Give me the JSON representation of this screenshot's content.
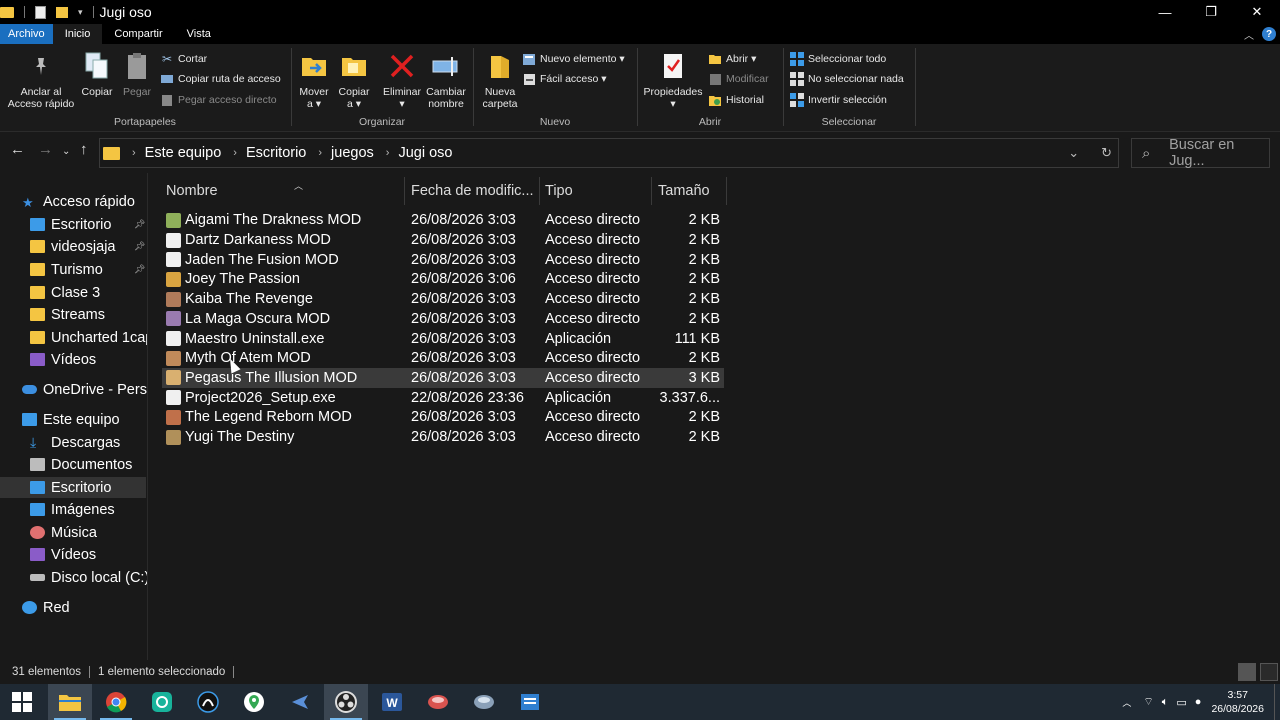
{
  "window": {
    "title": "Jugi oso",
    "minimize": "—",
    "maximize": "❐",
    "close": "✕"
  },
  "ribbon_tabs": [
    "Archivo",
    "Inicio",
    "Compartir",
    "Vista"
  ],
  "ribbon": {
    "portapapeles": {
      "label": "Portapapeles",
      "pin": "Anclar al\nAcceso rápido",
      "pin_l1": "Anclar al",
      "pin_l2": "Acceso rápido",
      "copy": "Copiar",
      "paste": "Pegar",
      "cut": "Cortar",
      "copy_path": "Copiar ruta de acceso",
      "paste_shortcut": "Pegar acceso directo"
    },
    "organizar": {
      "label": "Organizar",
      "move_l1": "Mover",
      "move_l2": "a ▾",
      "copyto_l1": "Copiar",
      "copyto_l2": "a ▾",
      "delete_l1": "Eliminar",
      "delete_l2": "▾",
      "rename_l1": "Cambiar",
      "rename_l2": "nombre"
    },
    "nuevo": {
      "label": "Nuevo",
      "folder_l1": "Nueva",
      "folder_l2": "carpeta",
      "new_item": "Nuevo elemento ▾",
      "easy_access": "Fácil acceso ▾"
    },
    "abrir": {
      "label": "Abrir",
      "props_l1": "Propiedades",
      "props_l2": "▾",
      "open": "Abrir ▾",
      "edit": "Modificar",
      "history": "Historial"
    },
    "seleccionar": {
      "label": "Seleccionar",
      "all": "Seleccionar todo",
      "none": "No seleccionar nada",
      "invert": "Invertir selección"
    }
  },
  "address": {
    "crumbs": [
      "Este equipo",
      "Escritorio",
      "juegos",
      "Jugi oso"
    ],
    "search_placeholder": "Buscar en Jug..."
  },
  "sidebar": [
    {
      "label": "Acceso rápido",
      "icon": "star-icon",
      "color": "#3c8fe0"
    },
    {
      "label": "Escritorio",
      "icon": "desktop-icon",
      "color": "#3c9be8",
      "pinned": true
    },
    {
      "label": "videosjaja",
      "icon": "folder-icon",
      "color": "#f4c542",
      "pinned": true
    },
    {
      "label": "Turismo",
      "icon": "folder-icon",
      "color": "#f4c542",
      "pinned": true
    },
    {
      "label": "Clase 3",
      "icon": "folder-icon",
      "color": "#f4c542"
    },
    {
      "label": "Streams",
      "icon": "folder-icon",
      "color": "#f4c542"
    },
    {
      "label": "Uncharted 1cap",
      "icon": "folder-icon",
      "color": "#f4c542"
    },
    {
      "label": "Vídeos",
      "icon": "video-icon",
      "color": "#8a5cc8"
    },
    {
      "label": "OneDrive - Perso",
      "icon": "cloud-icon",
      "color": "#3c8fe0"
    },
    {
      "label": "Este equipo",
      "icon": "computer-icon",
      "color": "#3c9be8"
    },
    {
      "label": "Descargas",
      "icon": "download-icon",
      "color": "#3c9be8"
    },
    {
      "label": "Documentos",
      "icon": "documents-icon",
      "color": "#bcbcbc"
    },
    {
      "label": "Escritorio",
      "icon": "desktop-icon",
      "color": "#3c9be8",
      "selected": true
    },
    {
      "label": "Imágenes",
      "icon": "pictures-icon",
      "color": "#3c9be8"
    },
    {
      "label": "Música",
      "icon": "music-icon",
      "color": "#e07070"
    },
    {
      "label": "Vídeos",
      "icon": "video-icon",
      "color": "#8a5cc8"
    },
    {
      "label": "Disco local (C:)",
      "icon": "drive-icon",
      "color": "#bcbcbc"
    },
    {
      "label": "Red",
      "icon": "network-icon",
      "color": "#3c9be8"
    }
  ],
  "columns": {
    "name": "Nombre",
    "date": "Fecha de modific...",
    "type": "Tipo",
    "size": "Tamaño"
  },
  "files": [
    {
      "name": "Aigami The Drakness MOD",
      "date": "26/08/2026 3:03",
      "type": "Acceso directo",
      "size": "2 KB",
      "color": "#8fb05a"
    },
    {
      "name": "Dartz Darkaness MOD",
      "date": "26/08/2026 3:03",
      "type": "Acceso directo",
      "size": "2 KB",
      "color": "#f0f0f0"
    },
    {
      "name": "Jaden The Fusion MOD",
      "date": "26/08/2026 3:03",
      "type": "Acceso directo",
      "size": "2 KB",
      "color": "#f0f0f0"
    },
    {
      "name": "Joey The Passion",
      "date": "26/08/2026 3:06",
      "type": "Acceso directo",
      "size": "2 KB",
      "color": "#d9a441"
    },
    {
      "name": "Kaiba The Revenge",
      "date": "26/08/2026 3:03",
      "type": "Acceso directo",
      "size": "2 KB",
      "color": "#b07b5a"
    },
    {
      "name": "La Maga Oscura MOD",
      "date": "26/08/2026 3:03",
      "type": "Acceso directo",
      "size": "2 KB",
      "color": "#9a7bb0"
    },
    {
      "name": "Maestro Uninstall.exe",
      "date": "26/08/2026 3:03",
      "type": "Aplicación",
      "size": "111 KB",
      "color": "#f0f0f0"
    },
    {
      "name": "Myth Of Atem MOD",
      "date": "26/08/2026 3:03",
      "type": "Acceso directo",
      "size": "2 KB",
      "color": "#c08a5a"
    },
    {
      "name": "Pegasus The Illusion MOD",
      "date": "26/08/2026 3:03",
      "type": "Acceso directo",
      "size": "3 KB",
      "color": "#d9b070",
      "selected": true
    },
    {
      "name": "Project2026_Setup.exe",
      "date": "22/08/2026 23:36",
      "type": "Aplicación",
      "size": "3.337.6...",
      "color": "#f0f0f0"
    },
    {
      "name": "The Legend Reborn MOD",
      "date": "26/08/2026 3:03",
      "type": "Acceso directo",
      "size": "2 KB",
      "color": "#c0704a"
    },
    {
      "name": "Yugi The Destiny",
      "date": "26/08/2026 3:03",
      "type": "Acceso directo",
      "size": "2 KB",
      "color": "#b0905a"
    }
  ],
  "status": {
    "count": "31 elementos",
    "selected": "1 elemento seleccionado"
  },
  "taskbar": {
    "apps": [
      "start-icon",
      "file-explorer-icon",
      "chrome-icon",
      "app-icon-teal",
      "app-icon-dark",
      "maps-icon",
      "app-icon-blue",
      "obs-icon",
      "word-icon",
      "app-icon-red",
      "app-icon-grey",
      "app-icon-blue2"
    ],
    "time": "3:57",
    "date": "26/08/2026"
  }
}
